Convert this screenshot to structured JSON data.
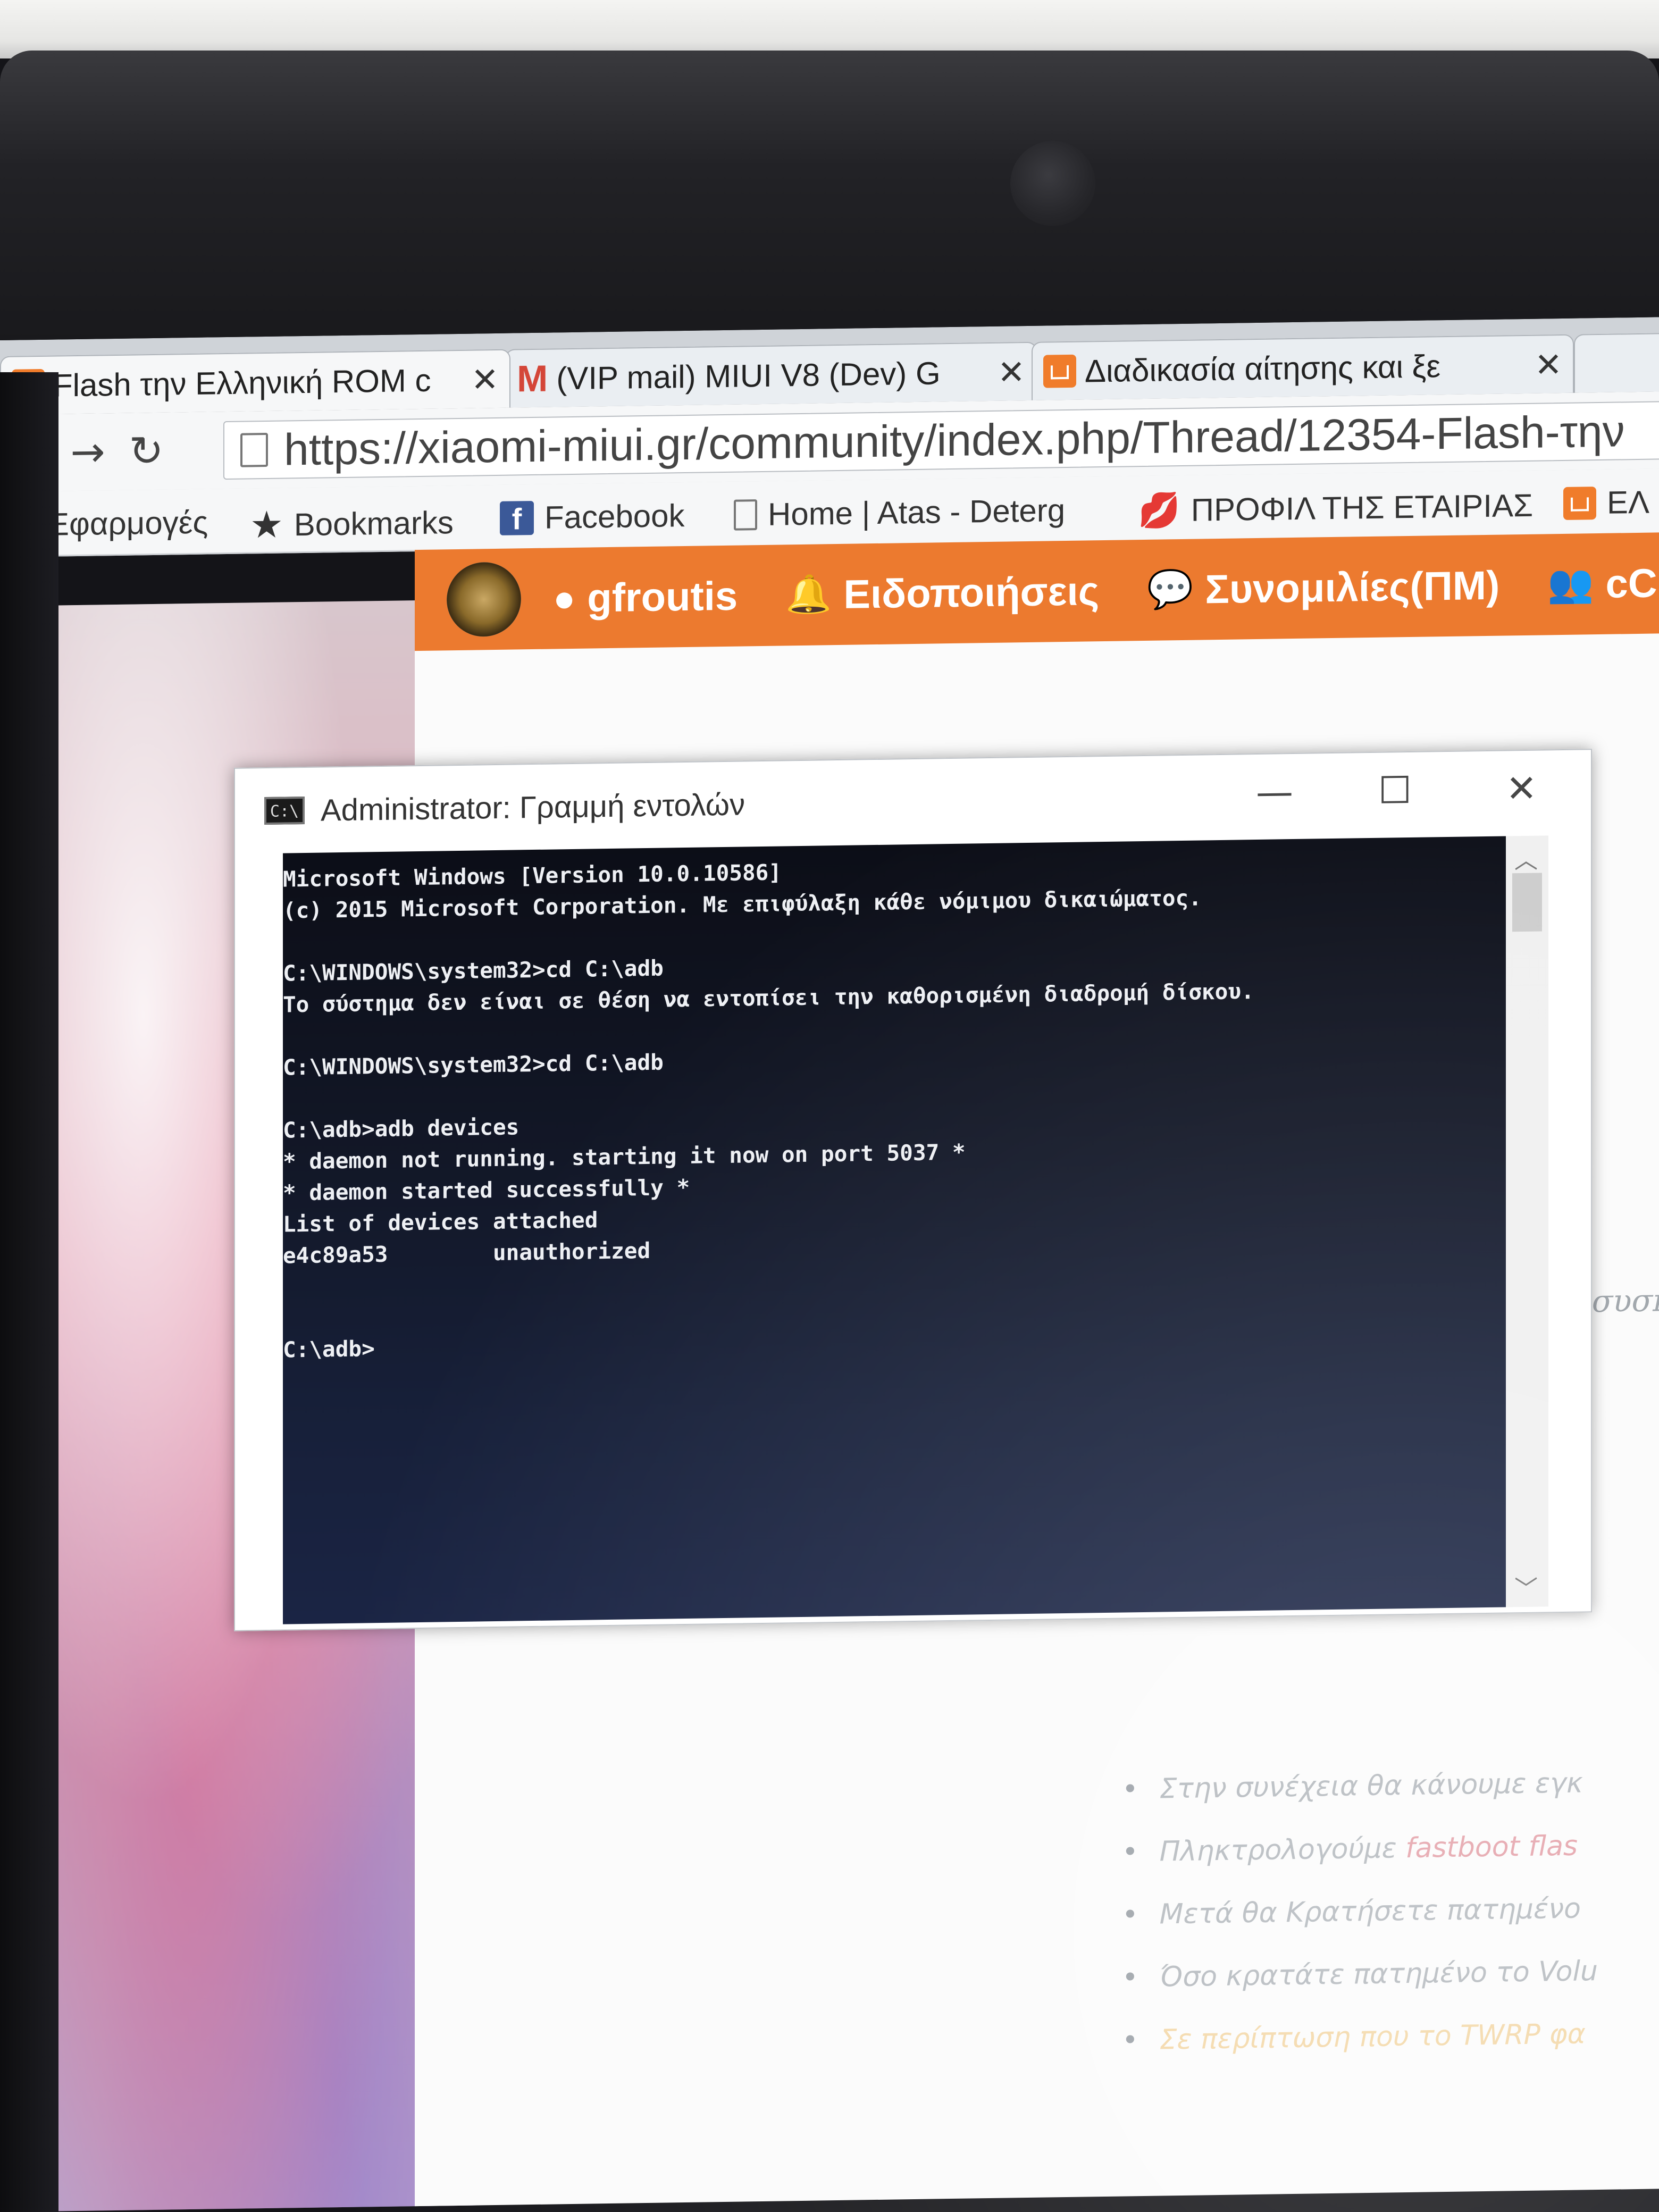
{
  "browser": {
    "tabs": [
      {
        "title": "Flash την Ελληνική ROM c",
        "close": "✕",
        "favicon": "house-icon"
      },
      {
        "title": "(VIP mail) MIUI V8 (Dev) G",
        "close": "✕",
        "favicon": "gmail-icon"
      },
      {
        "title": "Διαδικασία αίτησης και ξε",
        "close": "✕",
        "favicon": "house-icon"
      }
    ],
    "nav": {
      "back": "←",
      "forward": "→",
      "reload": "↻"
    },
    "url": "https://xiaomi-miui.gr/community/index.php/Thread/12354-Flash-την",
    "bookmarks": [
      {
        "label": "Εφαρμογές",
        "icon": "apps-grid-icon"
      },
      {
        "label": "Bookmarks",
        "icon": "star-icon"
      },
      {
        "label": "Facebook",
        "icon": "facebook-icon"
      },
      {
        "label": "Home | Atas - Deterg",
        "icon": "page-icon"
      },
      {
        "label": "ΠΡΟΦΙΛ ΤΗΣ ΕΤΑΙΡΙΑΣ",
        "icon": "lips-icon"
      },
      {
        "label": "ΕΛ",
        "icon": "house-icon"
      }
    ]
  },
  "forum": {
    "accent": "#ec7a2f",
    "nav": [
      {
        "label": "gfroutis",
        "icon": "user-icon"
      },
      {
        "label": "Ειδοποιήσεις",
        "icon": "bell-icon"
      },
      {
        "label": "Συνομιλίες(ΠΜ)",
        "icon": "chat-icon"
      },
      {
        "label": "cChat",
        "icon": "group-icon"
      }
    ],
    "partial_line": "ν συσκ",
    "bullets": [
      {
        "text": "Στην συνέχεια θα κάνουμε εγκ"
      },
      {
        "text": "Πληκτρολογούμε ",
        "highlight": "fastboot flas"
      },
      {
        "text": "Μετά θα Κρατήσετε πατημένο"
      },
      {
        "text": "Όσο κρατάτε πατημένο το Volu"
      },
      {
        "text": "Σε περίπτωση που το TWRP φα"
      }
    ]
  },
  "cmd": {
    "title": "Administrator: Γραμμή εντολών",
    "controls": {
      "minimize": "—",
      "maximize": "☐",
      "close": "✕"
    },
    "lines": [
      "Microsoft Windows [Version 10.0.10586]",
      "(c) 2015 Microsoft Corporation. Με επιφύλαξη κάθε νόμιμου δικαιώματος.",
      "",
      "C:\\WINDOWS\\system32>cd C:\\adb",
      "Το σύστημα δεν είναι σε θέση να εντοπίσει την καθορισμένη διαδρομή δίσκου.",
      "",
      "C:\\WINDOWS\\system32>cd C:\\adb",
      "",
      "C:\\adb>adb devices",
      "* daemon not running. starting it now on port 5037 *",
      "* daemon started successfully *",
      "List of devices attached",
      "e4c89a53        unauthorized",
      "",
      "",
      "C:\\adb>"
    ]
  }
}
